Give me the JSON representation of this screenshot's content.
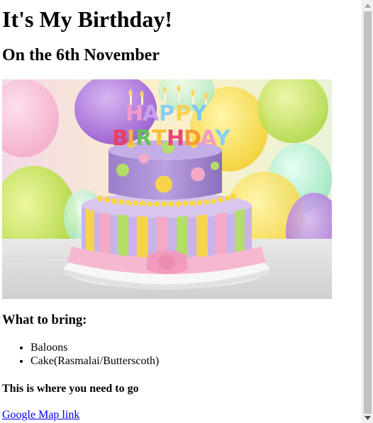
{
  "page": {
    "title": "It's My Birthday!",
    "subtitle": "On the 6th November",
    "image_alt": "Birthday cake with Happy Birthday candles",
    "cake_candle_text": "HAPPY BIRTHDAY"
  },
  "bring": {
    "heading": "What to bring:",
    "items": [
      "Baloons",
      "Cake(Rasmalai/Butterscoth)"
    ]
  },
  "directions": {
    "heading": "This is where you need to go",
    "link_label": "Google Map link"
  },
  "colors": {
    "link": "#0000ee",
    "scrollbar_track": "#f1f1f1",
    "scrollbar_thumb": "#c1c1c1"
  },
  "icons": {
    "scroll_up": "scroll-up-arrow-icon",
    "scroll_down": "scroll-down-arrow-icon"
  }
}
